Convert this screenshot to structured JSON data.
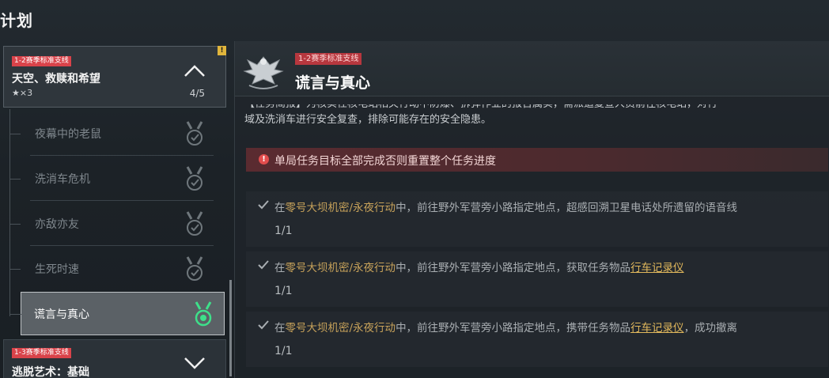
{
  "page": {
    "title": "计划"
  },
  "left": {
    "open_group": {
      "tag": "1-2赛季标准支线",
      "name": "天空、救赎和希望",
      "stars": "★×3",
      "progress": "4/5",
      "badge": "!"
    },
    "sub_tasks": [
      {
        "label": "夜幕中的老鼠",
        "state": "done"
      },
      {
        "label": "洗消车危机",
        "state": "done"
      },
      {
        "label": "亦敌亦友",
        "state": "done"
      },
      {
        "label": "生死时速",
        "state": "done"
      },
      {
        "label": "谎言与真心",
        "state": "active"
      }
    ],
    "closed_group": {
      "tag": "1-3赛季标准支线",
      "name": "逃脱艺术：基础"
    }
  },
  "right": {
    "tag": "1-2赛季标准支线",
    "title": "谎言与真心",
    "brief_line1": "【任务简报】为核实任核电站相关行动中防爆、拆弹作业的报告属实，需派遣复查人员前往核电站，对行",
    "brief_line2": "域及洗消车进行安全复查，排除可能存在的安全隐患。",
    "warning": "单局任务目标全部完成否则重置整个任务进度",
    "objectives": [
      {
        "prefix": "在",
        "mode": "零号大坝机密/永夜行动",
        "mid": "中，前往野外军营旁小路指定地点，超感回溯卫星电话处所遗留的语音线",
        "item": "",
        "suffix": "",
        "count": "1/1"
      },
      {
        "prefix": "在",
        "mode": "零号大坝机密/永夜行动",
        "mid": "中，前往野外军营旁小路指定地点，获取任务物品",
        "item": "行车记录仪",
        "suffix": "",
        "count": "1/1"
      },
      {
        "prefix": "在",
        "mode": "零号大坝机密/永夜行动",
        "mid": "中，前往野外军营旁小路指定地点，携带任务物品",
        "item": "行车记录仪",
        "suffix": "，成功撤离",
        "count": "1/1"
      }
    ]
  },
  "colors": {
    "tag_red": "#d9434a",
    "active_medal": "#3ee08a",
    "highlight_gold": "#c7a25a"
  },
  "icons": {
    "expand": "chevron-up-icon",
    "collapse": "chevron-down-icon",
    "medal": "medal-check-icon",
    "emblem": "eagle-emblem-icon",
    "alert": "alert-icon",
    "check": "check-icon"
  }
}
